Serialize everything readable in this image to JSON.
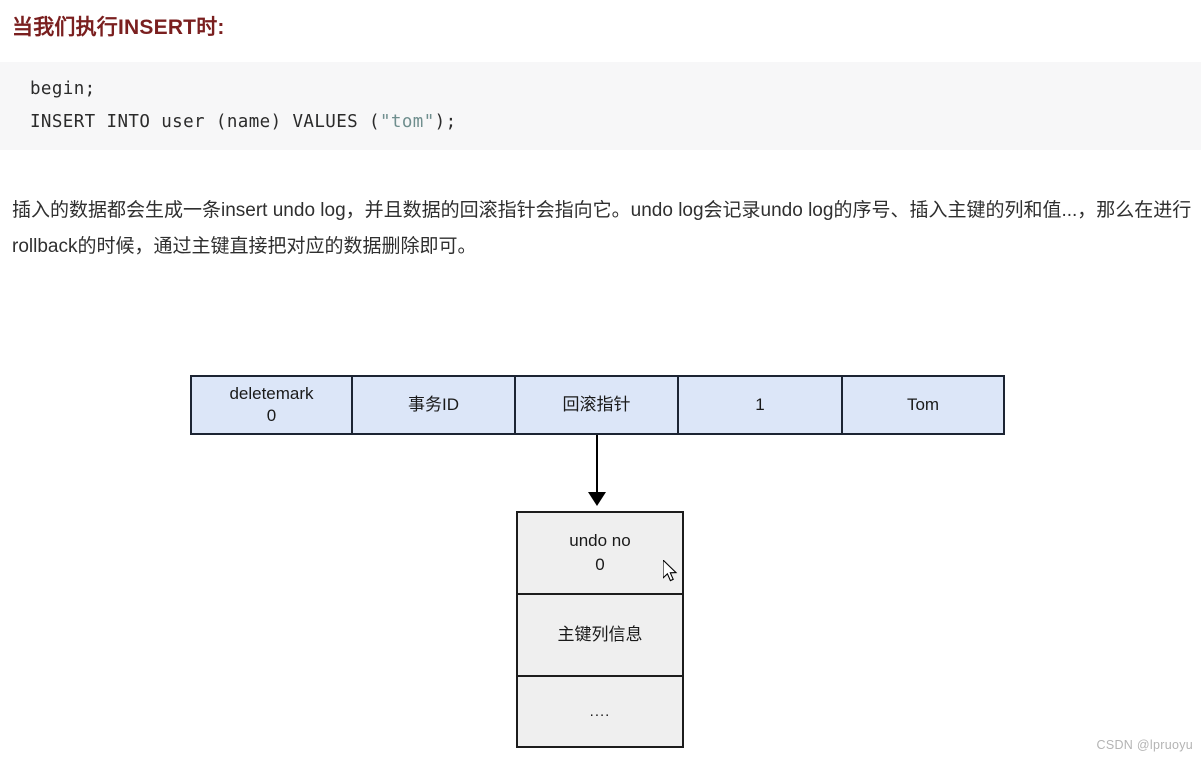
{
  "heading": "当我们执行INSERT时:",
  "code": {
    "line1": "begin;",
    "line2_pre": "INSERT INTO user (name) VALUES (",
    "line2_str": "\"tom\"",
    "line2_post": ");"
  },
  "body_text": "插入的数据都会生成一条insert undo log，并且数据的回滚指针会指向它。undo log会记录undo log的序号、插入主键的列和值...，那么在进行rollback的时候，通过主键直接把对应的数据删除即可。",
  "diagram": {
    "record_row": {
      "cells": [
        {
          "label": "deletemark",
          "sub": "0"
        },
        {
          "label": "事务ID",
          "sub": ""
        },
        {
          "label": "回滚指针",
          "sub": ""
        },
        {
          "label": "1",
          "sub": ""
        },
        {
          "label": "Tom",
          "sub": ""
        }
      ]
    },
    "arrow": {
      "name": "rollback-pointer-arrow"
    },
    "undo_box": {
      "cells": [
        {
          "label": "undo no",
          "sub": "0"
        },
        {
          "label": "主键列信息",
          "sub": ""
        },
        {
          "label": "....",
          "sub": ""
        }
      ]
    },
    "cursor": {
      "name": "mouse-pointer"
    }
  },
  "watermark": "CSDN @lpruoyu",
  "colors": {
    "heading": "#7a1f1f",
    "code_bg": "#f7f7f8",
    "code_string": "#6f8e8e",
    "record_fill": "#dce6f8",
    "record_border": "#1c2433",
    "undo_fill": "#efefef",
    "undo_border": "#1c1c1c",
    "watermark": "#b4b4b4"
  }
}
